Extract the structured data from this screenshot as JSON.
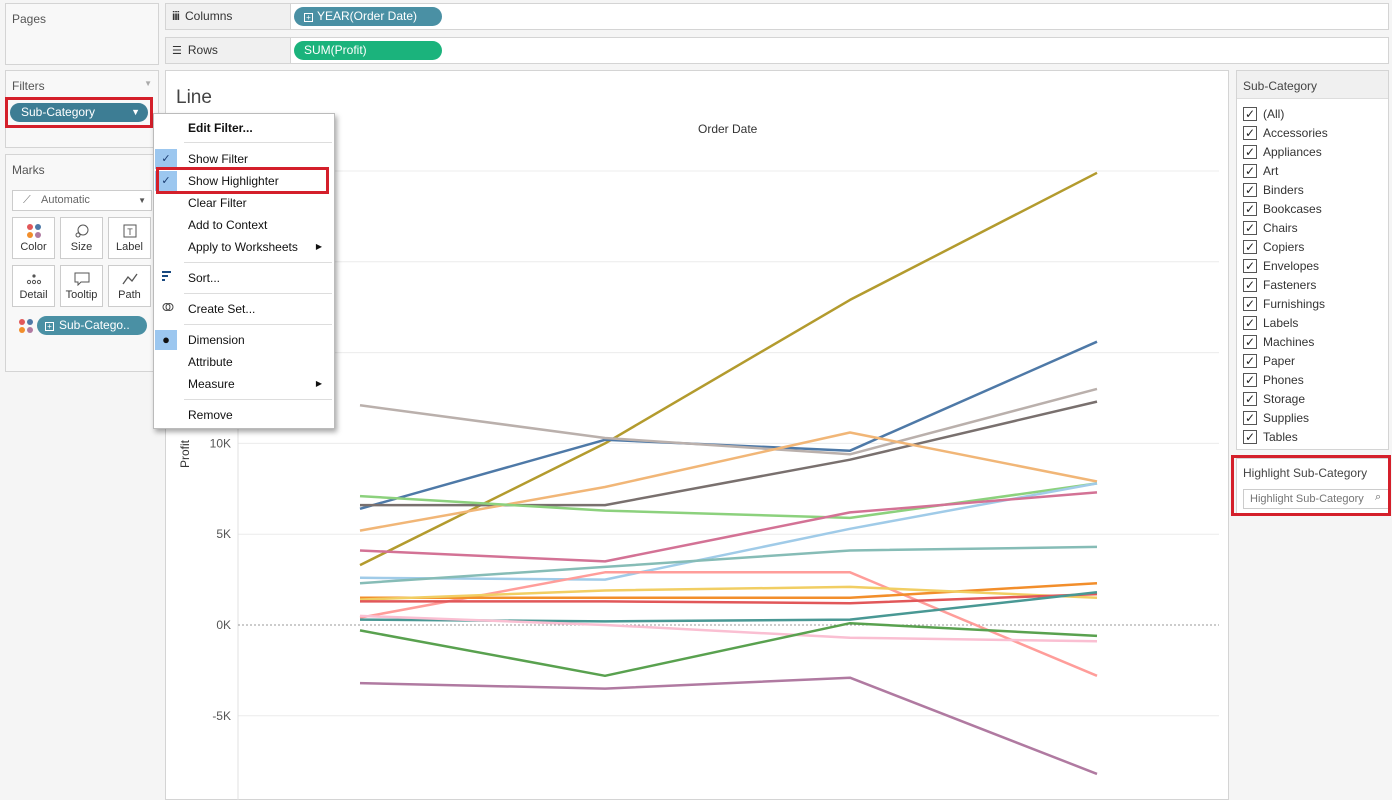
{
  "pages": {
    "title": "Pages"
  },
  "columns": {
    "label": "Columns",
    "pill": "YEAR(Order Date)",
    "pill_icon": "plus-box-icon"
  },
  "rows": {
    "label": "Rows",
    "pill": "SUM(Profit)"
  },
  "filters": {
    "title": "Filters",
    "pill": "Sub-Category"
  },
  "marks": {
    "title": "Marks",
    "type": "Automatic",
    "buttons": [
      "Color",
      "Size",
      "Label",
      "Detail",
      "Tooltip",
      "Path"
    ],
    "color_pill": "Sub-Catego.."
  },
  "context_menu": {
    "edit_filter": "Edit Filter...",
    "show_filter": "Show Filter",
    "show_highlighter": "Show Highlighter",
    "clear_filter": "Clear Filter",
    "add_to_context": "Add to Context",
    "apply_to_worksheets": "Apply to Worksheets",
    "sort": "Sort...",
    "create_set": "Create Set...",
    "dimension": "Dimension",
    "attribute": "Attribute",
    "measure": "Measure",
    "remove": "Remove"
  },
  "sheet": {
    "title": "Line",
    "header": "Order Date",
    "y_axis_label": "Profit"
  },
  "right_filter": {
    "title": "Sub-Category",
    "items": [
      "(All)",
      "Accessories",
      "Appliances",
      "Art",
      "Binders",
      "Bookcases",
      "Chairs",
      "Copiers",
      "Envelopes",
      "Fasteners",
      "Furnishings",
      "Labels",
      "Machines",
      "Paper",
      "Phones",
      "Storage",
      "Supplies",
      "Tables"
    ]
  },
  "highlighter": {
    "title": "Highlight Sub-Category",
    "placeholder": "Highlight Sub-Category"
  },
  "colors": {
    "accent_red": "#d41f2a",
    "pill_blue": "#4a90a4",
    "pill_green": "#1bb37c"
  },
  "chart_data": {
    "type": "line",
    "ylabel": "Profit",
    "ylim": [
      -9000,
      25000
    ],
    "yticks": [
      "-5K",
      "0K",
      "5K",
      "10K"
    ],
    "ytick_values": [
      -5000,
      0,
      5000,
      10000
    ],
    "x": [
      0,
      1,
      2,
      3
    ],
    "series": [
      {
        "color": "#b39b2e",
        "values": [
          3300,
          10000,
          17900,
          24900
        ]
      },
      {
        "color": "#4e79a7",
        "values": [
          6400,
          10200,
          9600,
          15600
        ]
      },
      {
        "color": "#bab0ac",
        "values": [
          12100,
          10300,
          9400,
          13000
        ]
      },
      {
        "color": "#79706e",
        "values": [
          6600,
          6600,
          9100,
          12300
        ]
      },
      {
        "color": "#f1b677",
        "values": [
          5200,
          7600,
          10600,
          7900
        ]
      },
      {
        "color": "#8cd17d",
        "values": [
          7100,
          6300,
          5900,
          7800
        ]
      },
      {
        "color": "#a0cbe8",
        "values": [
          2600,
          2500,
          5300,
          7800
        ]
      },
      {
        "color": "#d37295",
        "values": [
          4100,
          3500,
          6200,
          7300
        ]
      },
      {
        "color": "#86bcb6",
        "values": [
          2300,
          3200,
          4100,
          4300
        ]
      },
      {
        "color": "#ff9d9a",
        "values": [
          400,
          2900,
          2900,
          -2800
        ]
      },
      {
        "color": "#f28e2b",
        "values": [
          1500,
          1500,
          1500,
          2300
        ]
      },
      {
        "color": "#f1ce63",
        "values": [
          1400,
          1900,
          2100,
          1500
        ]
      },
      {
        "color": "#e15759",
        "values": [
          1300,
          1300,
          1200,
          1700
        ]
      },
      {
        "color": "#499894",
        "values": [
          300,
          200,
          300,
          1800
        ]
      },
      {
        "color": "#fabfd2",
        "values": [
          500,
          0,
          -700,
          -900
        ]
      },
      {
        "color": "#59a14f",
        "values": [
          -300,
          -2800,
          100,
          -600
        ]
      },
      {
        "color": "#b07aa1",
        "values": [
          -3200,
          -3500,
          -2900,
          -8200
        ]
      }
    ]
  }
}
